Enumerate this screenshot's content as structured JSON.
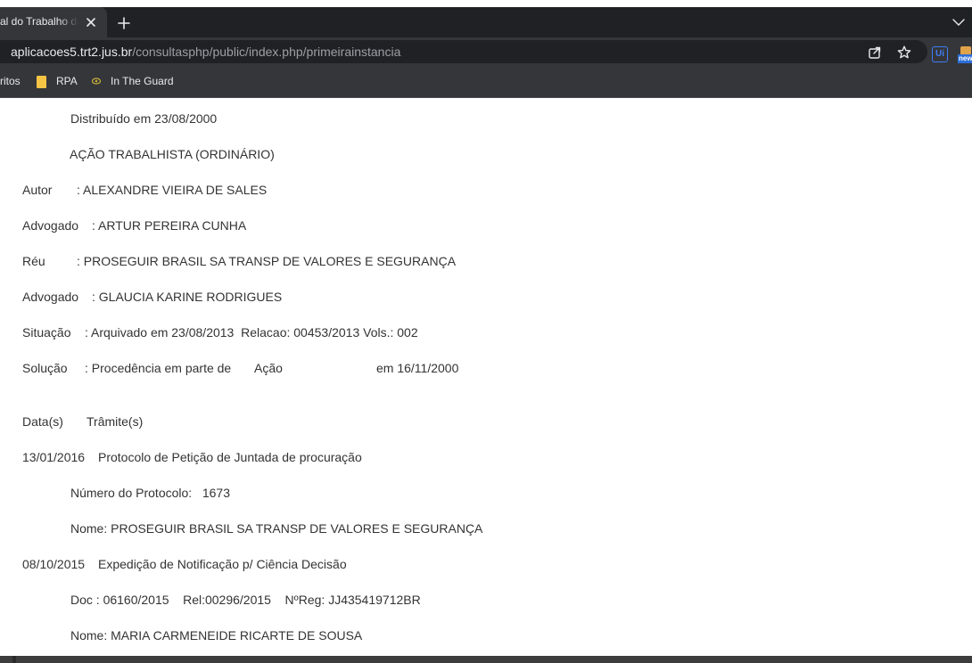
{
  "browser": {
    "tab_title": "al do Trabalho da",
    "url_host": "aplicacoes5.trt2.jus.br",
    "url_path": "/consultasphp/public/index.php/primeirainstancia",
    "extension_new_label": "new",
    "extension_ui_label": "Ui",
    "bookmarks": [
      {
        "label": "ritos"
      },
      {
        "label": "RPA"
      },
      {
        "label": "In The Guard"
      }
    ]
  },
  "case": {
    "distribuido": "Distribuído em 23/08/2000",
    "acao": "AÇÃO TRABALHISTA (ORDINÁRIO)",
    "autor_label": "Autor",
    "autor_value": ": ALEXANDRE VIEIRA DE SALES",
    "advogado1_label": "Advogado",
    "advogado1_value": ": ARTUR PEREIRA CUNHA",
    "reu_label": "Réu",
    "reu_value": ": PROSEGUIR BRASIL SA TRANSP DE VALORES E SEGURANÇA",
    "advogado2_label": "Advogado",
    "advogado2_value": ": GLAUCIA KARINE RODRIGUES",
    "situacao_label": "Situação",
    "situacao_value": ": Arquivado em 23/08/2013  Relacao: 00453/2013 Vols.: 002",
    "solucao_label": "Solução",
    "solucao_value": ": Procedência em parte de",
    "solucao_acao": "Ação",
    "solucao_date": "em 16/11/2000"
  },
  "tramites": {
    "header_data": "Data(s)",
    "header_tramite": "Trâmite(s)",
    "entries": [
      {
        "date": "13/01/2016",
        "description": "Protocolo de Petição de Juntada de procuração",
        "detail1": "Número do Protocolo:   1673",
        "detail2": "Nome: PROSEGUIR BRASIL SA TRANSP DE VALORES E SEGURANÇA"
      },
      {
        "date": "08/10/2015",
        "description": "Expedição de Notificação p/ Ciência Decisão",
        "detail1": "Doc : 06160/2015    Rel:00296/2015    NºReg: JJ435419712BR",
        "detail2": "Nome: MARIA CARMENEIDE RICARTE DE SOUSA"
      }
    ]
  },
  "colors": {
    "tabbar": "#202124",
    "toolbar": "#35363a",
    "page_text": "#333333"
  }
}
